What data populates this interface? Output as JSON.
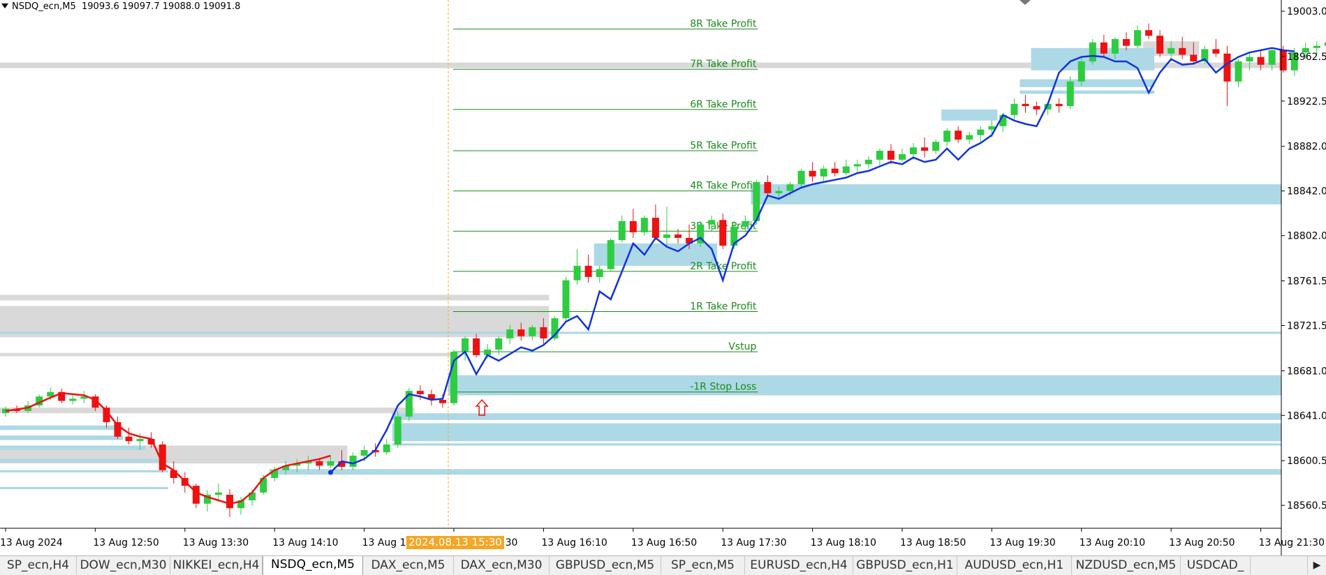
{
  "header": {
    "symbol": "NSDQ_ecn,M5",
    "ohlc": "19093.6 19097.7 19088.0 19091.8"
  },
  "colors": {
    "bull": "#2ecc40",
    "bear": "#ee1111",
    "ma_blue": "#1133dd",
    "ma_red": "#ee1111",
    "zone_blue": "#add8e6",
    "zone_gray": "#d9d9d9",
    "level_line": "#1a8a1a",
    "level_text": "#1a8a1a",
    "badge": "#f5a623"
  },
  "chart_data": {
    "type": "candlestick",
    "symbol": "NSDQ_ecn",
    "timeframe": "M5",
    "ylim": [
      18540,
      19013
    ],
    "y_ticks": [
      19003.0,
      18962.5,
      18922.5,
      18882.0,
      18842.0,
      18802.0,
      18761.5,
      18721.5,
      18681.0,
      18641.0,
      18600.5,
      18560.5
    ],
    "x_ticks": [
      {
        "label": "13 Aug 2024",
        "bar": 0
      },
      {
        "label": "13 Aug 12:50",
        "bar": 8
      },
      {
        "label": "13 Aug 13:30",
        "bar": 16
      },
      {
        "label": "13 Aug 14:10",
        "bar": 24
      },
      {
        "label": "13 Aug 14:50",
        "bar": 32
      },
      {
        "label": "13 Aug 15:30",
        "bar": 40
      },
      {
        "label": "13 Aug 16:10",
        "bar": 48
      },
      {
        "label": "13 Aug 16:50",
        "bar": 56
      },
      {
        "label": "13 Aug 17:30",
        "bar": 64
      },
      {
        "label": "13 Aug 18:10",
        "bar": 72
      },
      {
        "label": "13 Aug 18:50",
        "bar": 80
      },
      {
        "label": "13 Aug 19:30",
        "bar": 88
      },
      {
        "label": "13 Aug 20:10",
        "bar": 96
      },
      {
        "label": "13 Aug 20:50",
        "bar": 104
      },
      {
        "label": "13 Aug 21:30",
        "bar": 112
      }
    ],
    "cursor_label": "2024.08.13 15:30",
    "cursor_bar": 39.5,
    "candles": [
      [
        18643,
        18649,
        18640,
        18647
      ],
      [
        18647,
        18650,
        18643,
        18645
      ],
      [
        18645,
        18654,
        18643,
        18650
      ],
      [
        18650,
        18660,
        18648,
        18658
      ],
      [
        18658,
        18666,
        18655,
        18662
      ],
      [
        18662,
        18665,
        18652,
        18654
      ],
      [
        18654,
        18660,
        18651,
        18656
      ],
      [
        18656,
        18663,
        18652,
        18658
      ],
      [
        18658,
        18660,
        18645,
        18648
      ],
      [
        18648,
        18650,
        18630,
        18635
      ],
      [
        18635,
        18640,
        18620,
        18622
      ],
      [
        18622,
        18630,
        18615,
        18618
      ],
      [
        18618,
        18625,
        18610,
        18620
      ],
      [
        18620,
        18626,
        18612,
        18615
      ],
      [
        18615,
        18618,
        18590,
        18592
      ],
      [
        18592,
        18600,
        18580,
        18585
      ],
      [
        18585,
        18590,
        18572,
        18578
      ],
      [
        18578,
        18580,
        18558,
        18562
      ],
      [
        18562,
        18574,
        18555,
        18570
      ],
      [
        18570,
        18580,
        18565,
        18572
      ],
      [
        18570,
        18575,
        18550,
        18558
      ],
      [
        18558,
        18568,
        18552,
        18565
      ],
      [
        18565,
        18575,
        18560,
        18572
      ],
      [
        18572,
        18588,
        18570,
        18585
      ],
      [
        18585,
        18595,
        18582,
        18592
      ],
      [
        18592,
        18600,
        18588,
        18596
      ],
      [
        18596,
        18602,
        18590,
        18598
      ],
      [
        18598,
        18605,
        18592,
        18600
      ],
      [
        18600,
        18603,
        18592,
        18596
      ],
      [
        18596,
        18604,
        18594,
        18600
      ],
      [
        18600,
        18610,
        18592,
        18595
      ],
      [
        18595,
        18608,
        18592,
        18605
      ],
      [
        18605,
        18614,
        18600,
        18610
      ],
      [
        18610,
        18616,
        18604,
        18608
      ],
      [
        18608,
        18620,
        18606,
        18615
      ],
      [
        18615,
        18645,
        18612,
        18640
      ],
      [
        18640,
        18666,
        18636,
        18663
      ],
      [
        18663,
        18668,
        18655,
        18660
      ],
      [
        18660,
        18664,
        18650,
        18655
      ],
      [
        18655,
        18660,
        18648,
        18652
      ],
      [
        18652,
        18700,
        18650,
        18698
      ],
      [
        18698,
        18712,
        18690,
        18710
      ],
      [
        18710,
        18714,
        18693,
        18695
      ],
      [
        18695,
        18705,
        18692,
        18700
      ],
      [
        18700,
        18712,
        18695,
        18710
      ],
      [
        18710,
        18722,
        18705,
        18718
      ],
      [
        18718,
        18724,
        18708,
        18712
      ],
      [
        18712,
        18722,
        18708,
        18720
      ],
      [
        18720,
        18728,
        18705,
        18710
      ],
      [
        18710,
        18730,
        18708,
        18728
      ],
      [
        18728,
        18765,
        18726,
        18762
      ],
      [
        18762,
        18790,
        18758,
        18775
      ],
      [
        18775,
        18785,
        18760,
        18765
      ],
      [
        18765,
        18775,
        18760,
        18772
      ],
      [
        18772,
        18800,
        18770,
        18798
      ],
      [
        18798,
        18820,
        18796,
        18815
      ],
      [
        18815,
        18826,
        18800,
        18805
      ],
      [
        18805,
        18820,
        18802,
        18818
      ],
      [
        18818,
        18830,
        18798,
        18800
      ],
      [
        18800,
        18828,
        18792,
        18803
      ],
      [
        18803,
        18808,
        18795,
        18800
      ],
      [
        18800,
        18812,
        18790,
        18795
      ],
      [
        18795,
        18815,
        18792,
        18812
      ],
      [
        18812,
        18820,
        18805,
        18816
      ],
      [
        18816,
        18822,
        18790,
        18793
      ],
      [
        18793,
        18815,
        18790,
        18810
      ],
      [
        18810,
        18820,
        18805,
        18815
      ],
      [
        18815,
        18852,
        18812,
        18850
      ],
      [
        18850,
        18856,
        18836,
        18840
      ],
      [
        18840,
        18846,
        18836,
        18842
      ],
      [
        18842,
        18850,
        18838,
        18848
      ],
      [
        18848,
        18862,
        18845,
        18860
      ],
      [
        18860,
        18868,
        18850,
        18855
      ],
      [
        18855,
        18865,
        18850,
        18862
      ],
      [
        18862,
        18868,
        18855,
        18858
      ],
      [
        18858,
        18870,
        18856,
        18864
      ],
      [
        18864,
        18870,
        18858,
        18866
      ],
      [
        18866,
        18873,
        18862,
        18870
      ],
      [
        18870,
        18880,
        18865,
        18878
      ],
      [
        18878,
        18884,
        18866,
        18870
      ],
      [
        18870,
        18880,
        18868,
        18875
      ],
      [
        18875,
        18885,
        18870,
        18881
      ],
      [
        18881,
        18890,
        18872,
        18878
      ],
      [
        18878,
        18888,
        18875,
        18886
      ],
      [
        18886,
        18898,
        18882,
        18896
      ],
      [
        18896,
        18900,
        18885,
        18888
      ],
      [
        18888,
        18895,
        18884,
        18892
      ],
      [
        18892,
        18900,
        18886,
        18897
      ],
      [
        18897,
        18905,
        18890,
        18900
      ],
      [
        18900,
        18912,
        18895,
        18910
      ],
      [
        18910,
        18925,
        18905,
        18920
      ],
      [
        18920,
        18928,
        18912,
        18918
      ],
      [
        18918,
        18922,
        18910,
        18915
      ],
      [
        18915,
        18922,
        18910,
        18920
      ],
      [
        18920,
        18925,
        18912,
        18918
      ],
      [
        18918,
        18945,
        18915,
        18940
      ],
      [
        18940,
        18962,
        18936,
        18958
      ],
      [
        18958,
        18978,
        18955,
        18975
      ],
      [
        18975,
        18982,
        18962,
        18965
      ],
      [
        18965,
        18980,
        18960,
        18978
      ],
      [
        18978,
        18984,
        18968,
        18972
      ],
      [
        18972,
        18990,
        18970,
        18986
      ],
      [
        18986,
        18992,
        18978,
        18981
      ],
      [
        18981,
        18986,
        18962,
        18965
      ],
      [
        18965,
        18976,
        18958,
        18970
      ],
      [
        18970,
        18980,
        18960,
        18964
      ],
      [
        18964,
        18975,
        18955,
        18958
      ],
      [
        18958,
        18972,
        18956,
        18969
      ],
      [
        18969,
        18978,
        18962,
        18965
      ],
      [
        18965,
        18972,
        18918,
        18940
      ],
      [
        18940,
        18960,
        18935,
        18958
      ],
      [
        18958,
        18966,
        18950,
        18962
      ],
      [
        18962,
        18968,
        18950,
        18955
      ],
      [
        18955,
        18970,
        18950,
        18968
      ],
      [
        18968,
        18972,
        18948,
        18950
      ],
      [
        18950,
        18970,
        18945,
        18966
      ],
      [
        18966,
        18975,
        18960,
        18970
      ],
      [
        18970,
        18976,
        18964,
        18972
      ],
      [
        18972,
        18980,
        18968,
        18975
      ],
      [
        18975,
        18986,
        18972,
        18984
      ],
      [
        18984,
        18988,
        18975,
        18978
      ],
      [
        18978,
        18984,
        18970,
        18982
      ]
    ],
    "ma_red": [
      [
        0,
        18645
      ],
      [
        2,
        18648
      ],
      [
        4,
        18657
      ],
      [
        5,
        18661
      ],
      [
        7,
        18659
      ],
      [
        8,
        18655
      ],
      [
        9,
        18645
      ],
      [
        10,
        18632
      ],
      [
        11,
        18625
      ],
      [
        12,
        18622
      ],
      [
        13,
        18620
      ],
      [
        14,
        18598
      ],
      [
        15,
        18592
      ],
      [
        16,
        18582
      ],
      [
        17,
        18572
      ],
      [
        18,
        18568
      ],
      [
        19,
        18565
      ],
      [
        20,
        18562
      ],
      [
        21,
        18564
      ],
      [
        22,
        18572
      ],
      [
        23,
        18585
      ],
      [
        24,
        18592
      ],
      [
        25,
        18596
      ],
      [
        26,
        18598
      ],
      [
        27,
        18600
      ],
      [
        28,
        18602
      ],
      [
        29,
        18605
      ]
    ],
    "ma_blue": [
      [
        29,
        18590
      ],
      [
        30,
        18600
      ],
      [
        31,
        18598
      ],
      [
        32,
        18602
      ],
      [
        33,
        18610
      ],
      [
        34,
        18628
      ],
      [
        35,
        18650
      ],
      [
        36,
        18660
      ],
      [
        37,
        18658
      ],
      [
        38,
        18655
      ],
      [
        39,
        18656
      ],
      [
        40,
        18690
      ],
      [
        41,
        18698
      ],
      [
        42,
        18678
      ],
      [
        43,
        18695
      ],
      [
        44,
        18690
      ],
      [
        45,
        18696
      ],
      [
        46,
        18702
      ],
      [
        47,
        18699
      ],
      [
        48,
        18704
      ],
      [
        49,
        18713
      ],
      [
        50,
        18725
      ],
      [
        51,
        18730
      ],
      [
        52,
        18718
      ],
      [
        53,
        18752
      ],
      [
        54,
        18745
      ],
      [
        55,
        18770
      ],
      [
        56,
        18795
      ],
      [
        57,
        18785
      ],
      [
        58,
        18800
      ],
      [
        59,
        18792
      ],
      [
        60,
        18788
      ],
      [
        61,
        18795
      ],
      [
        62,
        18800
      ],
      [
        63,
        18790
      ],
      [
        64,
        18762
      ],
      [
        65,
        18795
      ],
      [
        66,
        18802
      ],
      [
        67,
        18816
      ],
      [
        68,
        18838
      ],
      [
        69,
        18835
      ],
      [
        70,
        18840
      ],
      [
        71,
        18845
      ],
      [
        72,
        18848
      ],
      [
        73,
        18850
      ],
      [
        74,
        18852
      ],
      [
        75,
        18854
      ],
      [
        76,
        18858
      ],
      [
        77,
        18860
      ],
      [
        78,
        18864
      ],
      [
        79,
        18868
      ],
      [
        80,
        18866
      ],
      [
        81,
        18872
      ],
      [
        82,
        18868
      ],
      [
        83,
        18870
      ],
      [
        84,
        18880
      ],
      [
        85,
        18870
      ],
      [
        86,
        18880
      ],
      [
        87,
        18885
      ],
      [
        88,
        18892
      ],
      [
        89,
        18910
      ],
      [
        90,
        18905
      ],
      [
        91,
        18902
      ],
      [
        92,
        18900
      ],
      [
        93,
        18920
      ],
      [
        94,
        18948
      ],
      [
        95,
        18958
      ],
      [
        96,
        18962
      ],
      [
        97,
        18963
      ],
      [
        98,
        18962
      ],
      [
        99,
        18958
      ],
      [
        100,
        18958
      ],
      [
        101,
        18952
      ],
      [
        102,
        18930
      ],
      [
        103,
        18948
      ],
      [
        104,
        18960
      ],
      [
        105,
        18955
      ],
      [
        106,
        18956
      ],
      [
        107,
        18960
      ],
      [
        108,
        18948
      ],
      [
        109,
        18956
      ],
      [
        110,
        18962
      ],
      [
        111,
        18966
      ],
      [
        112,
        18968
      ],
      [
        113,
        18970
      ],
      [
        114,
        18968
      ],
      [
        115,
        18967
      ]
    ],
    "levels": [
      {
        "label": "8R Take Profit",
        "y": 18987
      },
      {
        "label": "7R Take Profit",
        "y": 18951
      },
      {
        "label": "6R Take Profit",
        "y": 18915
      },
      {
        "label": "5R Take Profit",
        "y": 18878
      },
      {
        "label": "4R Take Profit",
        "y": 18842
      },
      {
        "label": "3R Take Profit",
        "y": 18806
      },
      {
        "label": "2R Take Profit",
        "y": 18770
      },
      {
        "label": "1R Take Profit",
        "y": 18734
      },
      {
        "label": "Vstup",
        "y": 18698
      },
      {
        "label": "-1R Stop Loss",
        "y": 18662
      }
    ],
    "zones_blue": [
      [
        0,
        -1,
        18714,
        18716
      ],
      [
        40,
        -1,
        18659,
        18677
      ],
      [
        35,
        -1,
        18637,
        18643
      ],
      [
        35,
        -1,
        18618,
        18634
      ],
      [
        35,
        -1,
        18614,
        18616
      ],
      [
        24,
        -1,
        18588,
        18593
      ],
      [
        67,
        -1,
        18830,
        18848
      ],
      [
        0,
        10,
        18628,
        18632
      ],
      [
        0,
        10,
        18619,
        18623
      ],
      [
        0,
        12,
        18610,
        18614
      ],
      [
        0,
        14,
        18599,
        18602
      ],
      [
        0,
        14,
        18590,
        18592
      ],
      [
        0,
        14,
        18575,
        18577
      ],
      [
        53,
        63,
        18775,
        18795
      ],
      [
        92,
        102,
        18950,
        18970
      ],
      [
        91,
        102,
        18935,
        18942
      ],
      [
        91,
        102,
        18929,
        18932
      ],
      [
        84,
        88,
        18905,
        18915
      ]
    ],
    "zones_gray": [
      [
        0,
        -1,
        18952,
        18957
      ],
      [
        0,
        48,
        18744,
        18749
      ],
      [
        0,
        48,
        18711,
        18739
      ],
      [
        0,
        40,
        18694,
        18697
      ],
      [
        0,
        36,
        18643,
        18648
      ],
      [
        0,
        30,
        18598,
        18614
      ],
      [
        102,
        106,
        18963,
        18976
      ]
    ],
    "arrow": {
      "bar": 42.5,
      "y": 18648
    },
    "dot": {
      "bar": 29,
      "y": 18590
    }
  },
  "tabs": [
    {
      "label": "SP_ecn,H4"
    },
    {
      "label": "DOW_ecn,M30"
    },
    {
      "label": "NIKKEI_ecn,H4"
    },
    {
      "label": "NSDQ_ecn,M5",
      "active": true
    },
    {
      "label": "DAX_ecn,M5"
    },
    {
      "label": "DAX_ecn,M30"
    },
    {
      "label": "GBPUSD_ecn,M5"
    },
    {
      "label": "SP_ecn,M5"
    },
    {
      "label": "EURUSD_ecn,H4"
    },
    {
      "label": "GBPUSD_ecn,H1"
    },
    {
      "label": "AUDUSD_ecn,H1"
    },
    {
      "label": "NZDUSD_ecn,M5"
    },
    {
      "label": "USDCAD_"
    }
  ]
}
